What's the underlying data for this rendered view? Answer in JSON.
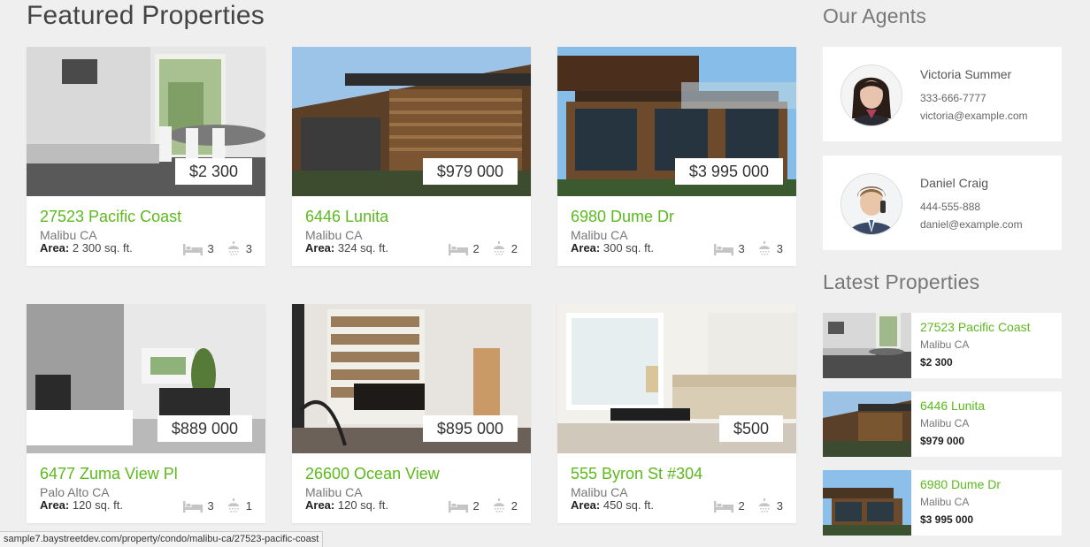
{
  "featured": {
    "title": "Featured Properties",
    "cards": [
      {
        "title": "27523 Pacific Coast",
        "city": "Malibu CA",
        "price": "$2 300",
        "area_label": "Area:",
        "area": " 2 300 sq. ft.",
        "beds": "3",
        "baths": "3",
        "photo": "kitchen-dining-photo"
      },
      {
        "title": "6446 Lunita",
        "city": "Malibu CA",
        "price": "$979 000",
        "area_label": "Area:",
        "area": " 324 sq. ft.",
        "beds": "2",
        "baths": "2",
        "photo": "wood-house-exterior-photo"
      },
      {
        "title": "6980 Dume Dr",
        "city": "Malibu CA",
        "price": "$3 995 000",
        "area_label": "Area:",
        "area": " 300 sq. ft.",
        "beds": "3",
        "baths": "3",
        "photo": "modern-house-exterior-photo"
      },
      {
        "title": "6477 Zuma View Pl",
        "city": "Palo Alto CA",
        "price": "$889 000",
        "area_label": "Area:",
        "area": " 120 sq. ft.",
        "beds": "3",
        "baths": "1",
        "photo": "living-room-fireplace-photo"
      },
      {
        "title": "26600 Ocean View",
        "city": "Malibu CA",
        "price": "$895 000",
        "area_label": "Area:",
        "area": " 120 sq. ft.",
        "beds": "2",
        "baths": "2",
        "photo": "library-piano-photo"
      },
      {
        "title": "555 Byron St #304",
        "city": "Malibu CA",
        "price": "$500",
        "area_label": "Area:",
        "area": " 450 sq. ft.",
        "beds": "2",
        "baths": "3",
        "photo": "bright-living-room-photo"
      }
    ]
  },
  "agents": {
    "title": "Our Agents",
    "items": [
      {
        "name": "Victoria Summer",
        "phone": "333-666-7777",
        "email": "victoria@example.com"
      },
      {
        "name": "Daniel Craig",
        "phone": "444-555-888",
        "email": "daniel@example.com"
      }
    ]
  },
  "latest": {
    "title": "Latest Properties",
    "items": [
      {
        "title": "27523 Pacific Coast",
        "city": "Malibu CA",
        "price": "$2 300"
      },
      {
        "title": "6446 Lunita",
        "city": "Malibu CA",
        "price": "$979 000"
      },
      {
        "title": "6980 Dume Dr",
        "city": "Malibu CA",
        "price": "$3 995 000"
      }
    ]
  },
  "status_bar": {
    "url": "sample7.baystreetdev.com/property/condo/malibu-ca/27523-pacific-coast"
  },
  "colors": {
    "accent": "#5cba1d",
    "background": "#efefef",
    "card": "#ffffff"
  },
  "icons": [
    "bed-icon",
    "shower-icon"
  ]
}
